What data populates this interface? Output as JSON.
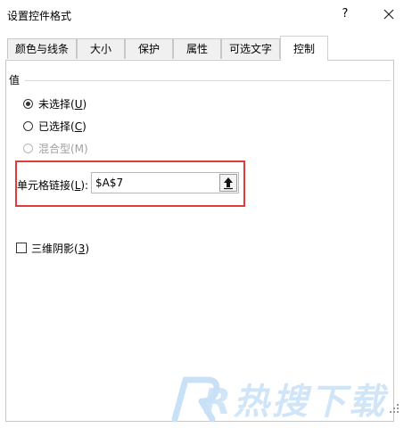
{
  "window": {
    "title": "设置控件格式",
    "help_glyph": "?",
    "close_icon": "close-icon"
  },
  "tabs": [
    {
      "label": "颜色与线条",
      "active": false
    },
    {
      "label": "大小",
      "active": false
    },
    {
      "label": "保护",
      "active": false
    },
    {
      "label": "属性",
      "active": false
    },
    {
      "label": "可选文字",
      "active": false
    },
    {
      "label": "控制",
      "active": true
    }
  ],
  "value_section": {
    "title": "值",
    "options": [
      {
        "text": "未选择(",
        "key": "U",
        "tail": ")",
        "checked": true,
        "enabled": true
      },
      {
        "text": "已选择(",
        "key": "C",
        "tail": ")",
        "checked": false,
        "enabled": true
      },
      {
        "text": "混合型(M)",
        "key": "",
        "tail": "",
        "checked": false,
        "enabled": false
      }
    ]
  },
  "cell_link": {
    "label_prefix": "单元格链接(",
    "label_key": "L",
    "label_suffix": "):",
    "value": "$A$7",
    "button_icon": "collapse-dialog-icon"
  },
  "shading_3d": {
    "text": "三维阴影(",
    "key": "3",
    "tail": ")",
    "checked": false
  },
  "watermark": {
    "text": "R热搜下载"
  },
  "colors": {
    "highlight_border": "#e23b3b",
    "disabled_text": "#a0a0a0",
    "watermark": "#c9e1f7"
  }
}
